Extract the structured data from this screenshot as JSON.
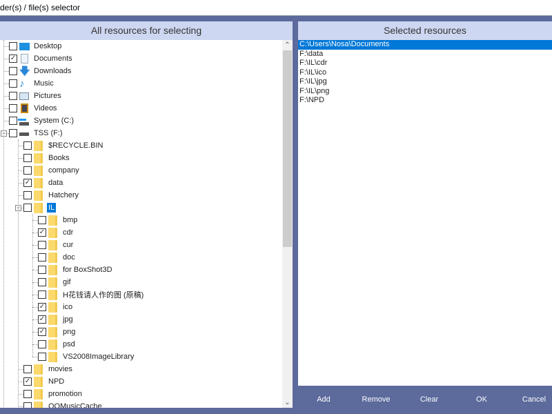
{
  "window": {
    "title": "der(s) / file(s) selector"
  },
  "left_panel": {
    "title": "All resources for selecting"
  },
  "right_panel": {
    "title": "Selected resources"
  },
  "tree": [
    {
      "label": "Desktop",
      "level": 0,
      "checked": false,
      "icon": "desktop-icon"
    },
    {
      "label": "Documents",
      "level": 0,
      "checked": true,
      "icon": "documents-icon"
    },
    {
      "label": "Downloads",
      "level": 0,
      "checked": false,
      "icon": "downloads-icon"
    },
    {
      "label": "Music",
      "level": 0,
      "checked": false,
      "icon": "music-icon"
    },
    {
      "label": "Pictures",
      "level": 0,
      "checked": false,
      "icon": "pictures-icon"
    },
    {
      "label": "Videos",
      "level": 0,
      "checked": false,
      "icon": "videos-icon"
    },
    {
      "label": "System (C:)",
      "level": 0,
      "checked": false,
      "icon": "system-drive-icon"
    },
    {
      "label": "TSS (F:)",
      "level": 0,
      "checked": false,
      "icon": "drive-icon",
      "expanded": true
    },
    {
      "label": "$RECYCLE.BIN",
      "level": 1,
      "checked": false,
      "icon": "folder-icon"
    },
    {
      "label": "Books",
      "level": 1,
      "checked": false,
      "icon": "folder-icon"
    },
    {
      "label": "company",
      "level": 1,
      "checked": false,
      "icon": "folder-icon"
    },
    {
      "label": "data",
      "level": 1,
      "checked": true,
      "icon": "folder-icon"
    },
    {
      "label": "Hatchery",
      "level": 1,
      "checked": false,
      "icon": "folder-icon"
    },
    {
      "label": "IL",
      "level": 1,
      "checked": false,
      "icon": "folder-icon",
      "expanded": true,
      "selected": true
    },
    {
      "label": "bmp",
      "level": 2,
      "checked": false,
      "icon": "folder-icon"
    },
    {
      "label": "cdr",
      "level": 2,
      "checked": true,
      "icon": "folder-icon"
    },
    {
      "label": "cur",
      "level": 2,
      "checked": false,
      "icon": "folder-icon"
    },
    {
      "label": "doc",
      "level": 2,
      "checked": false,
      "icon": "folder-icon"
    },
    {
      "label": "for BoxShot3D",
      "level": 2,
      "checked": false,
      "icon": "folder-icon"
    },
    {
      "label": "gif",
      "level": 2,
      "checked": false,
      "icon": "folder-icon"
    },
    {
      "label": "H花钱请人作的图 (原稿)",
      "level": 2,
      "checked": false,
      "icon": "folder-icon"
    },
    {
      "label": "ico",
      "level": 2,
      "checked": true,
      "icon": "folder-icon"
    },
    {
      "label": "jpg",
      "level": 2,
      "checked": true,
      "icon": "folder-icon"
    },
    {
      "label": "png",
      "level": 2,
      "checked": true,
      "icon": "folder-icon"
    },
    {
      "label": "psd",
      "level": 2,
      "checked": false,
      "icon": "folder-icon"
    },
    {
      "label": "VS2008ImageLibrary",
      "level": 2,
      "checked": false,
      "icon": "folder-icon"
    },
    {
      "label": "movies",
      "level": 1,
      "checked": false,
      "icon": "folder-icon"
    },
    {
      "label": "NPD",
      "level": 1,
      "checked": true,
      "icon": "folder-icon"
    },
    {
      "label": "promotion",
      "level": 1,
      "checked": false,
      "icon": "folder-icon"
    },
    {
      "label": "QQMusicCache",
      "level": 1,
      "checked": false,
      "icon": "folder-icon"
    }
  ],
  "selected_resources": [
    "C:\\Users\\Nosa\\Documents",
    "F:\\data",
    "F:\\IL\\cdr",
    "F:\\IL\\ico",
    "F:\\IL\\jpg",
    "F:\\IL\\png",
    "F:\\NPD"
  ],
  "buttons": {
    "add": "Add",
    "remove": "Remove",
    "clear": "Clear",
    "ok": "OK",
    "cancel": "Cancel"
  },
  "colors": {
    "background": "#5c6a9c",
    "header": "#cdd7f1",
    "selection": "#0078d7",
    "folder": "#fbd96c"
  }
}
